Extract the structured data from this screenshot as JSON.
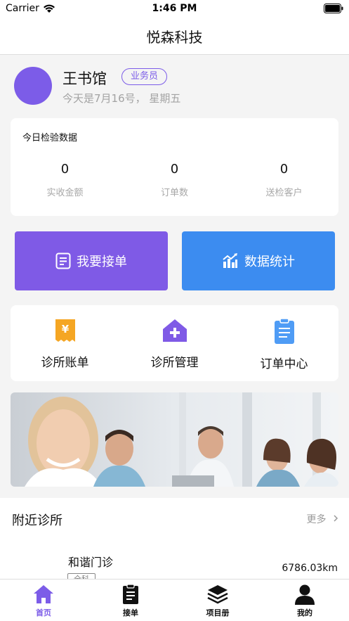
{
  "status_bar": {
    "carrier": "Carrier",
    "time": "1:46 PM"
  },
  "nav": {
    "title": "悦森科技"
  },
  "profile": {
    "name": "王书馆",
    "role": "业务员",
    "date_text": "今天是7月16号， 星期五"
  },
  "stats": {
    "title": "今日检验数据",
    "items": [
      {
        "value": "0",
        "label": "实收金额"
      },
      {
        "value": "0",
        "label": "订单数"
      },
      {
        "value": "0",
        "label": "送检客户"
      }
    ]
  },
  "actions": {
    "accept_label": "我要接单",
    "stats_label": "数据统计"
  },
  "menu": {
    "items": [
      {
        "label": "诊所账单",
        "icon": "bill-icon"
      },
      {
        "label": "诊所管理",
        "icon": "clinic-house-icon"
      },
      {
        "label": "订单中心",
        "icon": "clipboard-icon"
      }
    ]
  },
  "nearby": {
    "title": "附近诊所",
    "more": "更多",
    "clinic": {
      "name": "和谐门诊",
      "distance": "6786.03km",
      "tag": "全科"
    }
  },
  "tabs": [
    {
      "label": "首页",
      "icon": "home-icon",
      "active": true
    },
    {
      "label": "接单",
      "icon": "order-clipboard-icon",
      "active": false
    },
    {
      "label": "项目册",
      "icon": "layers-icon",
      "active": false
    },
    {
      "label": "我的",
      "icon": "user-icon",
      "active": false
    }
  ],
  "colors": {
    "purple": "#7f5ae6",
    "blue": "#3c8cf0",
    "orange": "#f5a623",
    "light_blue": "#4f9cf5"
  }
}
